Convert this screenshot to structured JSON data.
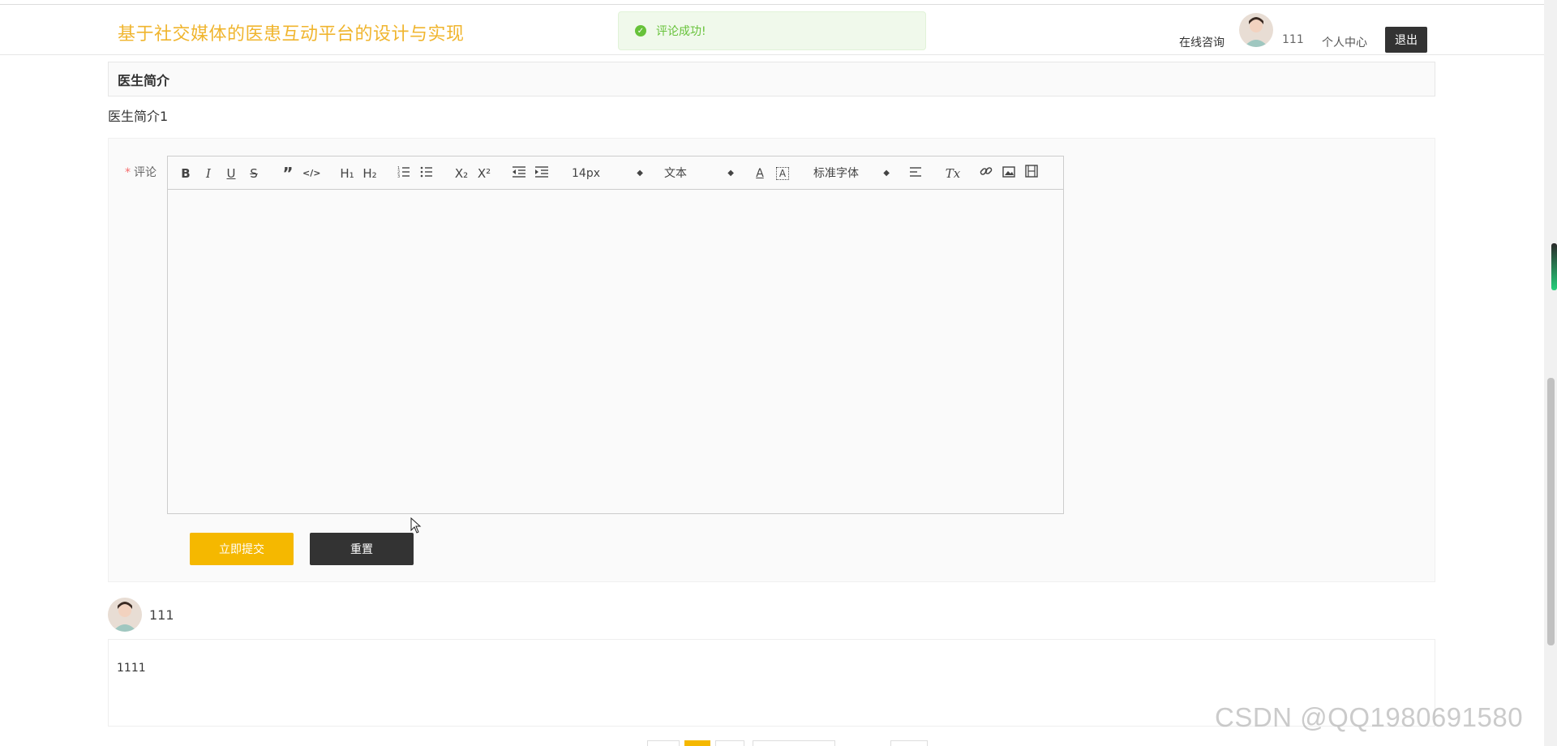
{
  "header": {
    "site_title": "基于社交媒体的医患互动平台的设计与实现",
    "nav_consult": "在线咨询",
    "username": "111",
    "personal_center": "个人中心",
    "logout_label": "退出"
  },
  "toast": {
    "message": "评论成功!",
    "icon": "success-check-icon",
    "color": "#67c23a"
  },
  "doctor_intro": {
    "heading": "医生简介",
    "body": "医生简介1"
  },
  "comment_form": {
    "required_mark": "*",
    "label": "评论",
    "editor_value": "",
    "toolbar": {
      "bold": "B",
      "italic": "I",
      "underline": "U",
      "strike": "S",
      "blockquote": "”",
      "code": "</>",
      "h1": "H₁",
      "h2": "H₂",
      "ordered_list": "ordered-list-icon",
      "bullet_list": "bullet-list-icon",
      "subscript": "X₂",
      "superscript": "X²",
      "outdent": "outdent-icon",
      "indent": "indent-icon",
      "font_size": "14px",
      "header_select": "文本",
      "text_color": "A",
      "background_color": "A",
      "font_family": "标准字体",
      "align": "align-left-icon",
      "clean": "Tx",
      "link": "link-icon",
      "image": "image-icon",
      "video": "video-icon"
    },
    "submit_label": "立即提交",
    "reset_label": "重置"
  },
  "comments": [
    {
      "username": "111",
      "content": "1111"
    }
  ],
  "colors": {
    "brand": "#f0b52e",
    "submit": "#f5b800",
    "dark": "#333333"
  },
  "watermark": "CSDN @QQ1980691580"
}
